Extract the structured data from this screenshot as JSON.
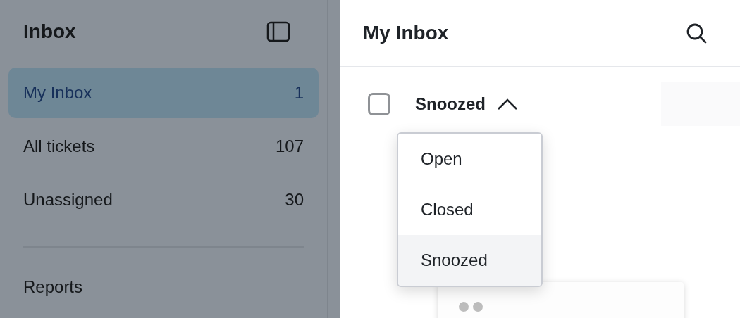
{
  "sidebar": {
    "title": "Inbox",
    "items": [
      {
        "label": "My Inbox",
        "count": "1",
        "selected": true
      },
      {
        "label": "All tickets",
        "count": "107",
        "selected": false
      },
      {
        "label": "Unassigned",
        "count": "30",
        "selected": false
      }
    ],
    "links": [
      "Reports"
    ]
  },
  "main": {
    "title": "My Inbox",
    "list_header": {
      "checked": false,
      "filter": "Snoozed",
      "expanded": true
    },
    "filter_menu": [
      {
        "label": "Open",
        "selected": false
      },
      {
        "label": "Closed",
        "selected": false
      },
      {
        "label": "Snoozed",
        "selected": true
      }
    ]
  }
}
